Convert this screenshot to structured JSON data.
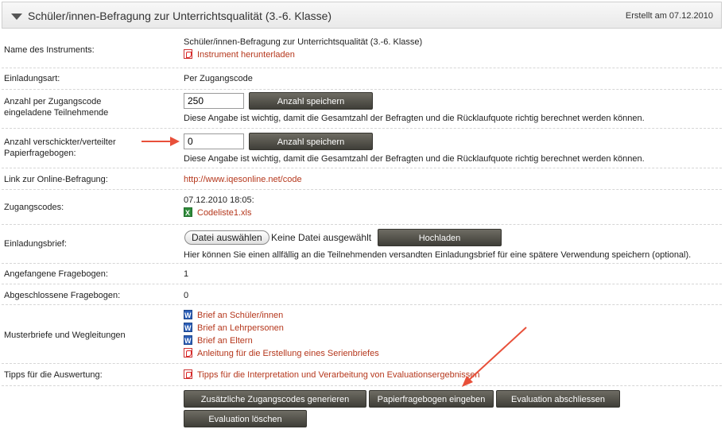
{
  "header": {
    "title": "Schüler/innen-Befragung zur Unterrichtsqualität (3.-6. Klasse)",
    "created": "Erstellt am 07.12.2010"
  },
  "rows": {
    "instrument": {
      "label": "Name des Instruments:",
      "name": "Schüler/innen-Befragung zur Unterrichtsqualität (3.-6. Klasse)",
      "download_link": "Instrument herunterladen"
    },
    "invitation_type": {
      "label": "Einladungsart:",
      "value": "Per Zugangscode"
    },
    "invited_count": {
      "label_line1": "Anzahl per Zugangscode",
      "label_line2": "eingeladene Teilnehmende",
      "input_value": "250",
      "button": "Anzahl speichern",
      "hint": "Diese Angabe ist wichtig, damit die Gesamtzahl der Befragten und die Rücklaufquote richtig berechnet werden können."
    },
    "paper_count": {
      "label_line1": "Anzahl verschickter/verteilter",
      "label_line2": "Papierfragebogen:",
      "input_value": "0",
      "button": "Anzahl speichern",
      "hint": "Diese Angabe ist wichtig, damit die Gesamtzahl der Befragten und die Rücklaufquote richtig berechnet werden können."
    },
    "online_link": {
      "label": "Link zur Online-Befragung:",
      "url": "http://www.iqesonline.net/code"
    },
    "access_codes": {
      "label": "Zugangscodes:",
      "timestamp": "07.12.2010 18:05:",
      "file": "Codeliste1.xls"
    },
    "invitation_letter": {
      "label": "Einladungsbrief:",
      "choose_file": "Datei auswählen",
      "no_file": "Keine Datei ausgewählt",
      "upload_button": "Hochladen",
      "hint": "Hier können Sie einen allfällig an die Teilnehmenden versandten Einladungsbrief für eine spätere Verwendung speichern (optional)."
    },
    "started": {
      "label": "Angefangene Fragebogen:",
      "value": "1"
    },
    "completed": {
      "label": "Abgeschlossene Fragebogen:",
      "value": "0"
    },
    "templates": {
      "label": "Musterbriefe und Wegleitungen",
      "links": [
        {
          "text": "Brief an Schüler/innen",
          "icon": "word-doc-icon"
        },
        {
          "text": "Brief an Lehrpersonen",
          "icon": "word-doc-icon"
        },
        {
          "text": "Brief an Eltern",
          "icon": "word-doc-icon"
        },
        {
          "text": "Anleitung für die Erstellung eines Serienbriefes",
          "icon": "pdf-icon"
        }
      ]
    },
    "tips": {
      "label": "Tipps für die Auswertung:",
      "link": "Tipps für die Interpretation und Verarbeitung von Evaluationsergebnissen"
    }
  },
  "actions": {
    "generate_codes": "Zusätzliche Zugangscodes generieren",
    "enter_paper": "Papierfragebogen eingeben",
    "close_evaluation": "Evaluation abschliessen",
    "delete_evaluation": "Evaluation löschen"
  },
  "colors": {
    "link": "#b5371c",
    "button": "#4f4e47",
    "annotation_arrow": "#e8503a"
  }
}
